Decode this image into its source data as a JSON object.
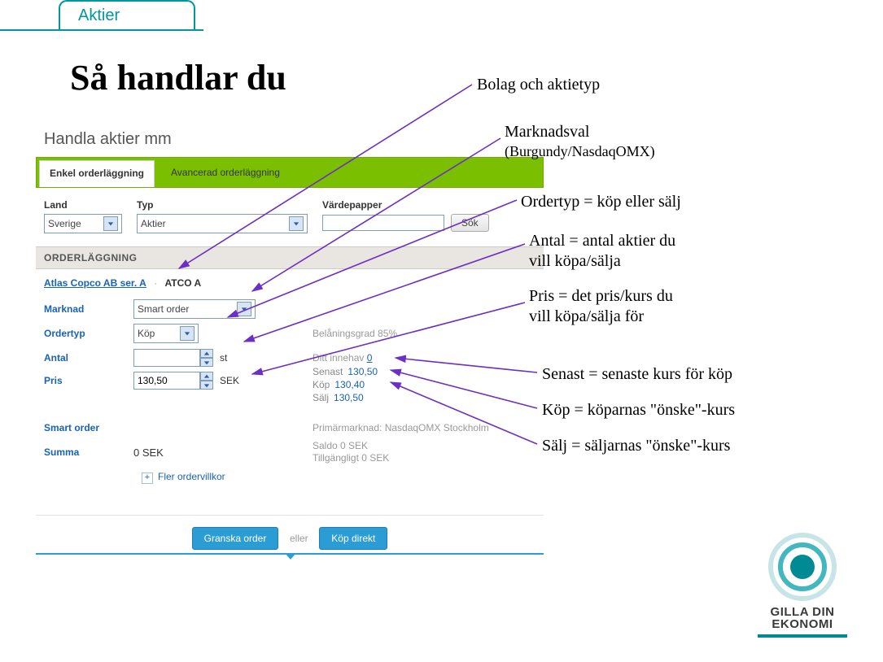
{
  "topTab": "Aktier",
  "title": "Så handlar du",
  "panel": {
    "header": "Handla aktier mm",
    "tabs": {
      "simple": "Enkel orderläggning",
      "advanced": "Avancerad orderläggning"
    },
    "filters": {
      "landLabel": "Land",
      "landValue": "Sverige",
      "typLabel": "Typ",
      "typValue": "Aktier",
      "vpLabel": "Värdepapper",
      "vpValue": "",
      "sok": "Sök"
    },
    "sectionTitle": "ORDERLÄGGNING",
    "stock": {
      "name": "Atlas Copco AB ser. A",
      "ticker": "ATCO A"
    },
    "fields": {
      "marknadLabel": "Marknad",
      "marknadValue": "Smart order",
      "ordertypLabel": "Ordertyp",
      "ordertypValue": "Köp",
      "belaning": "Belåningsgrad 85%",
      "antalLabel": "Antal",
      "antalValue": "",
      "antalUnit": "st",
      "innehavLabel": "Ditt innehav",
      "innehavValue": "0",
      "prisLabel": "Pris",
      "prisValue": "130,50",
      "prisUnit": "SEK",
      "senastLabel": "Senast",
      "senastValue": "130,50",
      "kopLabel": "Köp",
      "kopValue": "130,40",
      "saljLabel": "Sälj",
      "saljValue": "130,50",
      "smartLabel": "Smart order",
      "primMarknad": "Primärmarknad: NasdaqOMX Stockholm",
      "summaLabel": "Summa",
      "summaValue": "0 SEK",
      "saldo": "Saldo 0 SEK",
      "tillg": "Tillgängligt 0 SEK",
      "more": "Fler ordervillkor"
    },
    "actions": {
      "granska": "Granska order",
      "mid": "eller",
      "direkt": "Köp direkt"
    }
  },
  "annotations": {
    "a1": "Bolag och aktietyp",
    "a2a": "Marknadsval",
    "a2b": "(Burgundy/NasdaqOMX)",
    "a3": "Ordertyp = köp eller sälj",
    "a4a": "Antal = antal aktier du",
    "a4b": "vill köpa/sälja",
    "a5a": "Pris = det pris/kurs du",
    "a5b": "vill köpa/sälja för",
    "a6": "Senast = senaste kurs för köp",
    "a7": "Köp = köparnas \"önske\"-kurs",
    "a8": "Sälj = säljarnas \"önske\"-kurs"
  },
  "logo": {
    "line1": "GILLA DIN",
    "line2": "EKONOMI"
  }
}
